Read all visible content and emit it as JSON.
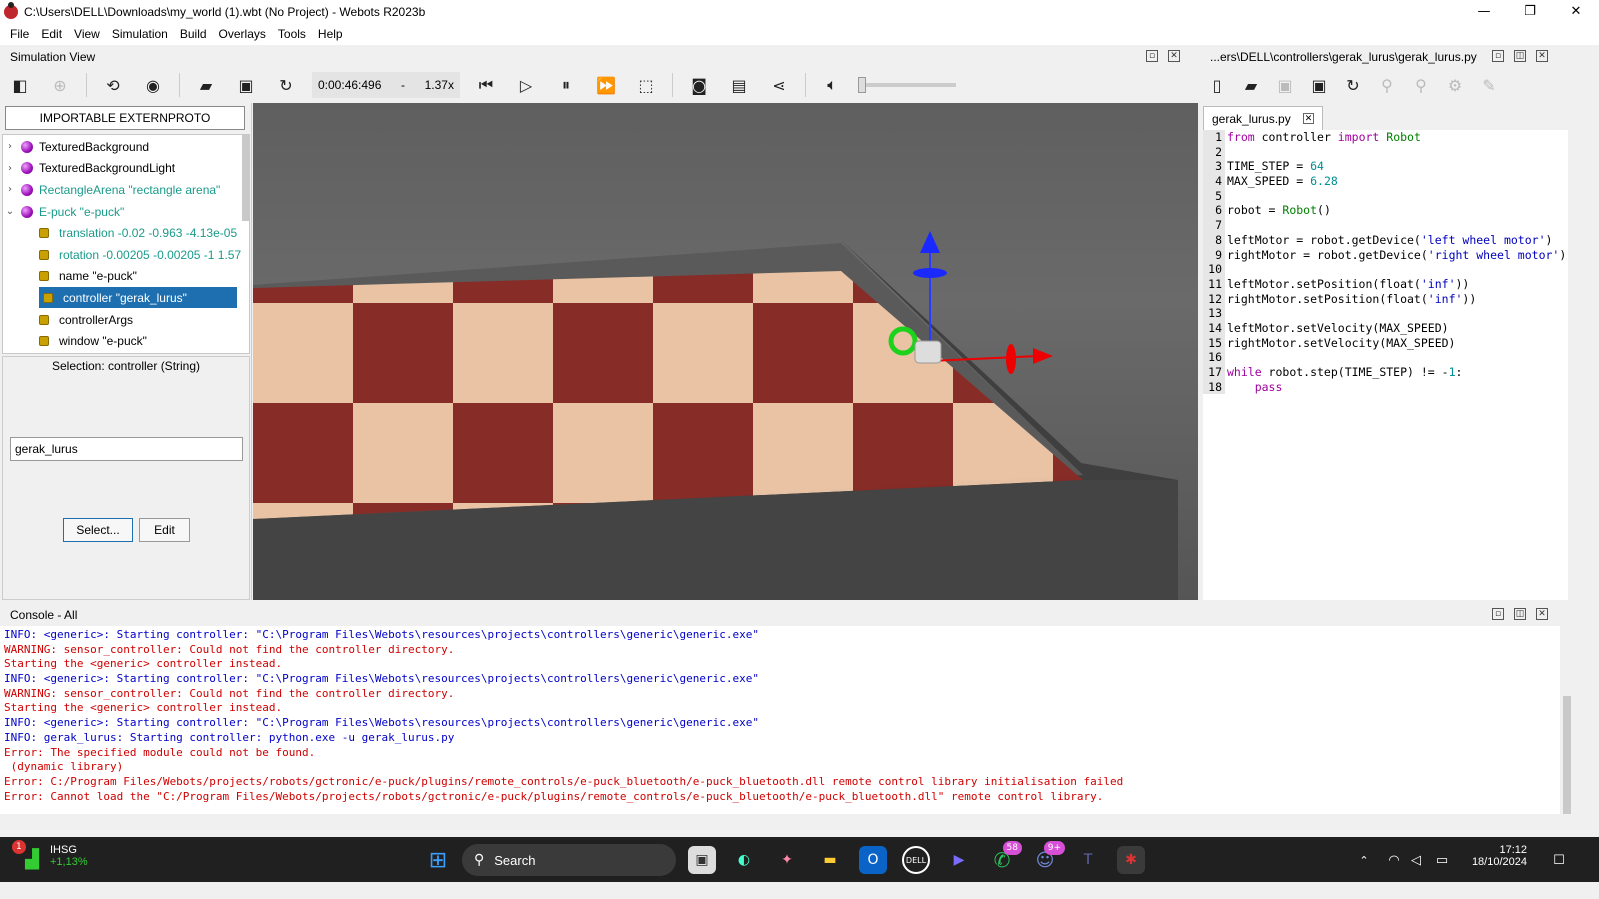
{
  "window": {
    "title": "C:\\Users\\DELL\\Downloads\\my_world (1).wbt (No Project) - Webots R2023b",
    "minimize": "—",
    "maximize": "❐",
    "close": "✕"
  },
  "menu": [
    "File",
    "Edit",
    "View",
    "Simulation",
    "Build",
    "Overlays",
    "Tools",
    "Help"
  ],
  "sim_view": {
    "header": "Simulation View",
    "time": "0:00:46:496",
    "time_sep": "-",
    "speed": "1.37x",
    "volume_level": 0.0
  },
  "scene_tree": {
    "import_button": "IMPORTABLE EXTERNPROTO",
    "nodes": [
      {
        "label": "TexturedBackground",
        "kind": "node",
        "expanded": false,
        "color": "default"
      },
      {
        "label": "TexturedBackgroundLight",
        "kind": "node",
        "expanded": false,
        "color": "default"
      },
      {
        "label": "RectangleArena \"rectangle arena\"",
        "kind": "node",
        "expanded": false,
        "color": "teal"
      },
      {
        "label": "E-puck \"e-puck\"",
        "kind": "node",
        "expanded": true,
        "color": "teal"
      },
      {
        "label": "translation -0.02 -0.963 -4.13e-05",
        "kind": "field",
        "color": "teal"
      },
      {
        "label": "rotation -0.00205 -0.00205 -1 1.57",
        "kind": "field",
        "color": "teal"
      },
      {
        "label": "name \"e-puck\"",
        "kind": "field",
        "color": "default"
      },
      {
        "label": "controller \"gerak_lurus\"",
        "kind": "field",
        "color": "selected"
      },
      {
        "label": "controllerArgs",
        "kind": "field",
        "color": "default"
      },
      {
        "label": "window \"e-puck\"",
        "kind": "field",
        "color": "default"
      }
    ]
  },
  "field_editor": {
    "selection": "Selection: controller (String)",
    "value": "gerak_lurus",
    "select_button": "Select...",
    "edit_button": "Edit"
  },
  "editor": {
    "header": "...ers\\DELL\\controllers\\gerak_lurus\\gerak_lurus.py",
    "tab": "gerak_lurus.py",
    "tab_close": "✕",
    "lines": [
      "from controller import Robot",
      "",
      "TIME_STEP = 64",
      "MAX_SPEED = 6.28",
      "",
      "robot = Robot()",
      "",
      "leftMotor = robot.getDevice('left wheel motor')",
      "rightMotor = robot.getDevice('right wheel motor')",
      "",
      "leftMotor.setPosition(float('inf'))",
      "rightMotor.setPosition(float('inf'))",
      "",
      "leftMotor.setVelocity(MAX_SPEED)",
      "rightMotor.setVelocity(MAX_SPEED)",
      "",
      "while robot.step(TIME_STEP) != -1:",
      "    pass"
    ]
  },
  "console": {
    "header": "Console - All",
    "lines": [
      {
        "level": "info",
        "text": "INFO: <generic>: Starting controller: \"C:\\Program Files\\Webots\\resources\\projects\\controllers\\generic\\generic.exe\""
      },
      {
        "level": "warn",
        "text": "WARNING: sensor_controller: Could not find the controller directory."
      },
      {
        "level": "warn",
        "text": "Starting the <generic> controller instead."
      },
      {
        "level": "info",
        "text": "INFO: <generic>: Starting controller: \"C:\\Program Files\\Webots\\resources\\projects\\controllers\\generic\\generic.exe\""
      },
      {
        "level": "warn",
        "text": "WARNING: sensor_controller: Could not find the controller directory."
      },
      {
        "level": "warn",
        "text": "Starting the <generic> controller instead."
      },
      {
        "level": "info",
        "text": "INFO: <generic>: Starting controller: \"C:\\Program Files\\Webots\\resources\\projects\\controllers\\generic\\generic.exe\""
      },
      {
        "level": "info",
        "text": "INFO: gerak_lurus: Starting controller: python.exe -u gerak_lurus.py"
      },
      {
        "level": "err",
        "text": "Error: The specified module could not be found."
      },
      {
        "level": "err",
        "text": " (dynamic library)"
      },
      {
        "level": "err",
        "text": "Error: C:/Program Files/Webots/projects/robots/gctronic/e-puck/plugins/remote_controls/e-puck_bluetooth/e-puck_bluetooth.dll remote control library initialisation failed"
      },
      {
        "level": "err",
        "text": "Error: Cannot load the \"C:/Program Files/Webots/projects/robots/gctronic/e-puck/plugins/remote_controls/e-puck_bluetooth/e-puck_bluetooth.dll\" remote control library."
      }
    ]
  },
  "taskbar": {
    "stock_badge": "1",
    "stock_name": "IHSG",
    "stock_change": "+1,13%",
    "search_label": "Search",
    "whatsapp_badge": "58",
    "discord_badge": "9+",
    "time": "17:12",
    "date": "18/10/2024"
  },
  "colors": {
    "info": "#0000c8",
    "error": "#d00000",
    "selection": "#1e6fb0",
    "teal_node": "#1a9a8a"
  }
}
